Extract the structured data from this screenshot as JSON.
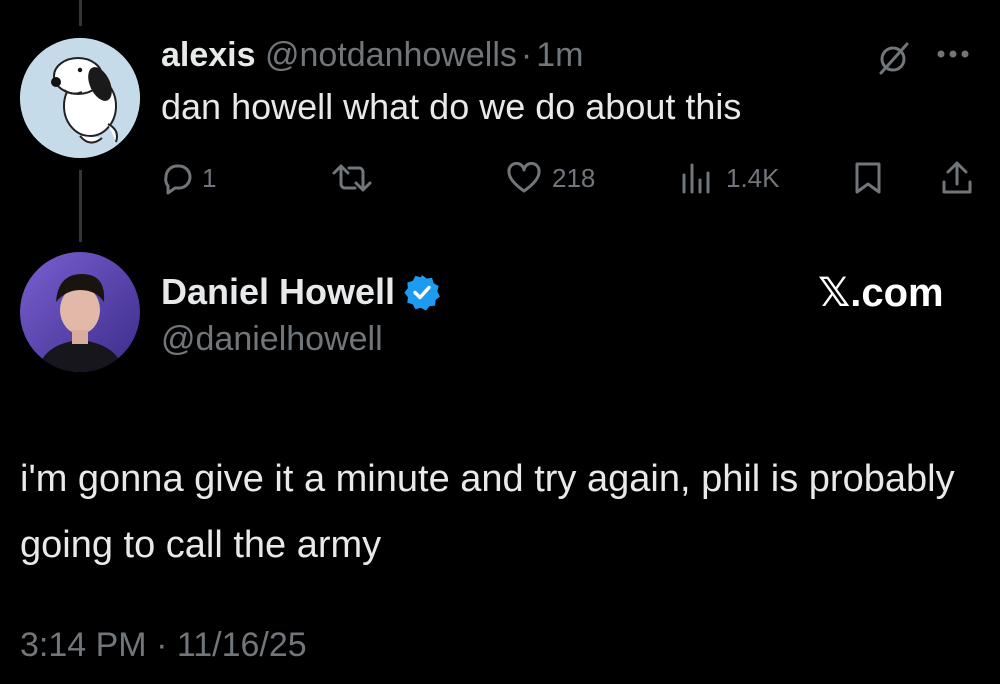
{
  "reply": {
    "display_name": "alexis",
    "handle": "@notdanhowells",
    "separator": "·",
    "time": "1m",
    "text": "dan howell what do we do about this",
    "actions": {
      "replies": "1",
      "retweets": "",
      "likes": "218",
      "views": "1.4K"
    }
  },
  "main": {
    "display_name": "Daniel Howell",
    "handle": "@danielhowell",
    "brand": "𝕏.com",
    "text": "i'm gonna give it a minute and try again, phil is probably going to call the army",
    "timestamp": "3:14 PM · 11/16/25"
  },
  "colors": {
    "background": "#000000",
    "text": "#e7e9ea",
    "muted": "#71767b",
    "verified": "#1d9bf0",
    "thread_line": "#333639"
  },
  "icons": [
    "reply-icon",
    "retweet-icon",
    "like-icon",
    "views-icon",
    "bookmark-icon",
    "share-icon",
    "grok-icon",
    "more-icon",
    "verified-badge-icon"
  ]
}
